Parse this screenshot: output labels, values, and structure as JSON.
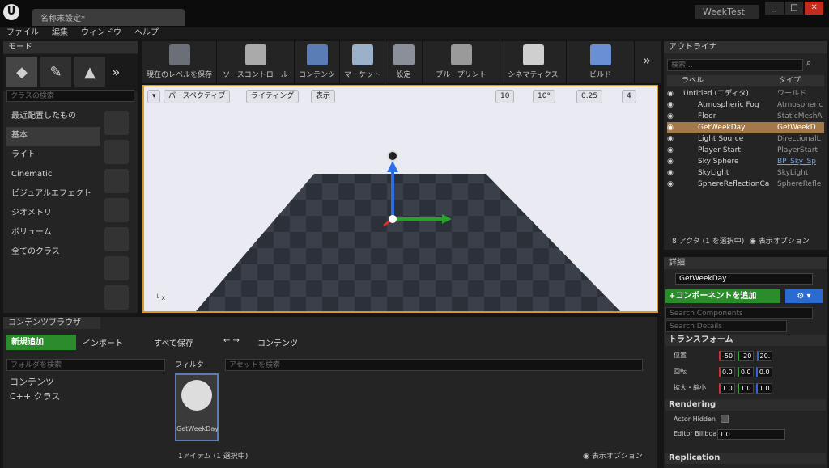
{
  "window": {
    "tab_title": "名称未設定*",
    "project": "WeekTest",
    "controls": [
      "_",
      "□",
      "✕"
    ]
  },
  "menu": [
    "ファイル",
    "編集",
    "ウィンドウ",
    "ヘルプ"
  ],
  "modes": {
    "tab": "モード",
    "search_placeholder": "クラスの検索",
    "categories": [
      "最近配置したもの",
      "基本",
      "ライト",
      "Cinematic",
      "ビジュアルエフェクト",
      "ジオメトリ",
      "ボリューム",
      "全てのクラス"
    ],
    "selected_category": "基本"
  },
  "toolbar": [
    "現在のレベルを保存",
    "ソースコントロール",
    "コンテンツ",
    "マーケット",
    "設定",
    "ブループリント",
    "シネマティクス",
    "ビルド"
  ],
  "viewport": {
    "perspective": "パースペクティブ",
    "lighting": "ライティング",
    "show": "表示",
    "grid_snap": "10",
    "rot_snap": "10°",
    "scale_snap": "0.25",
    "cam_speed": "4"
  },
  "outliner": {
    "tab": "アウトライナ",
    "search_placeholder": "検索...",
    "col_label": "ラベル",
    "col_type": "タイプ",
    "rows": [
      {
        "label": "Untitled (エディタ)",
        "type": "ワールド",
        "selected": false
      },
      {
        "label": "Atmospheric Fog",
        "type": "Atmospheric",
        "selected": false
      },
      {
        "label": "Floor",
        "type": "StaticMeshA",
        "selected": false
      },
      {
        "label": "GetWeekDay",
        "type": "GetWeekD",
        "selected": true
      },
      {
        "label": "Light Source",
        "type": "DirectionalL",
        "selected": false
      },
      {
        "label": "Player Start",
        "type": "PlayerStart",
        "selected": false
      },
      {
        "label": "Sky Sphere",
        "type": "BP_Sky_Sp",
        "selected": false
      },
      {
        "label": "SkyLight",
        "type": "SkyLight",
        "selected": false
      },
      {
        "label": "SphereReflectionCa",
        "type": "SphereRefle",
        "selected": false
      }
    ],
    "status": "8 アクタ (1 を選択中)",
    "view_options": "表示オプション"
  },
  "details": {
    "tab": "詳細",
    "actor_name": "GetWeekDay",
    "add_component": "+コンポーネントを追加",
    "search_components": "Search Components",
    "search_details": "Search Details",
    "transform_header": "トランスフォーム",
    "position_label": "位置",
    "position": [
      "-50",
      "-20",
      "20."
    ],
    "rotation_label": "回転",
    "rotation": [
      "0.0",
      "0.0",
      "0.0"
    ],
    "scale_label": "拡大・縮小",
    "scale": [
      "1.0",
      "1.0",
      "1.0"
    ],
    "rendering_header": "Rendering",
    "actor_hidden_label": "Actor Hidden",
    "editor_billboard_label": "Editor Billboa",
    "editor_billboard_value": "1.0",
    "replication_header": "Replication"
  },
  "content_browser": {
    "tab": "コンテンツブラウザ",
    "add_new": "新規追加",
    "import": "インポート",
    "save_all": "すべて保存",
    "path": "コンテンツ",
    "folder_search_placeholder": "フォルダを検索",
    "filter": "フィルタ",
    "asset_search_placeholder": "アセットを検索",
    "tree": [
      "コンテンツ",
      "C++ クラス"
    ],
    "asset_name": "GetWeekDay",
    "status": "1アイテム (1 選択中)",
    "view_options": "表示オプション"
  }
}
